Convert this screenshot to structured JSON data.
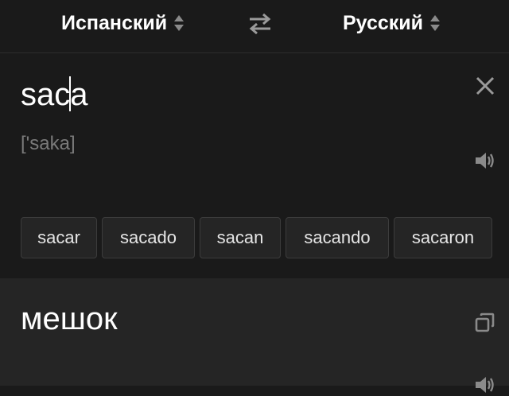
{
  "header": {
    "source_language": "Испанский",
    "target_language": "Русский"
  },
  "input": {
    "query": "saca",
    "transcription": "['saka]"
  },
  "suggestions": [
    "sacar",
    "sacado",
    "sacan",
    "sacando",
    "sacaron"
  ],
  "result": {
    "translation": "мешок"
  },
  "icons": {
    "language_selector": "up-down-triangles-icon",
    "swap": "swap-arrows-icon",
    "clear": "close-icon",
    "speaker": "speaker-icon",
    "copy": "copy-icon"
  },
  "colors": {
    "background": "#1a1a1a",
    "result_background": "#252525",
    "chip_background": "#252525",
    "chip_border": "#3c3c3c",
    "text_primary": "#ffffff",
    "text_secondary": "#7a7a7a",
    "icon_color": "#8a8a8a"
  }
}
